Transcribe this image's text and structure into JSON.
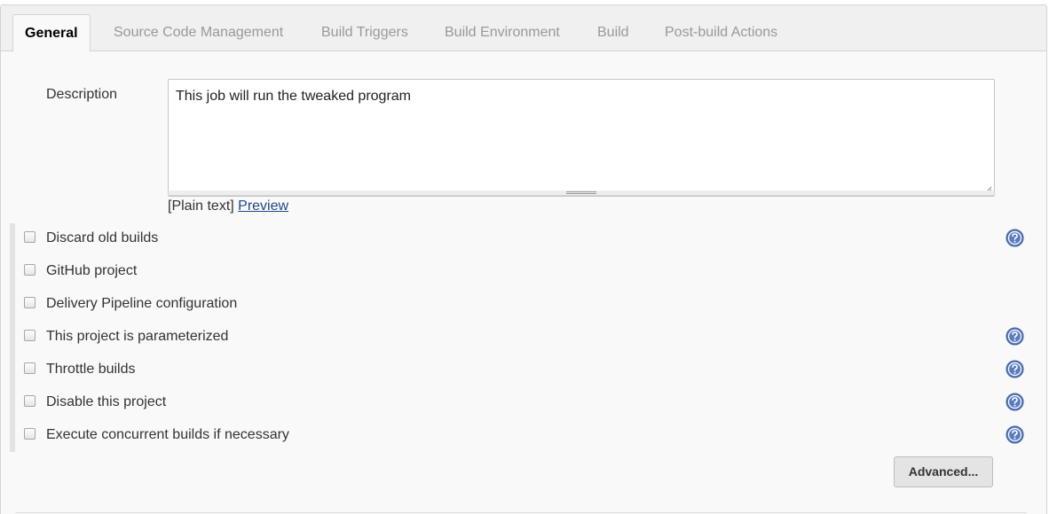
{
  "tabs": [
    {
      "label": "General",
      "active": true
    },
    {
      "label": "Source Code Management",
      "active": false
    },
    {
      "label": "Build Triggers",
      "active": false
    },
    {
      "label": "Build Environment",
      "active": false
    },
    {
      "label": "Build",
      "active": false
    },
    {
      "label": "Post-build Actions",
      "active": false
    }
  ],
  "description": {
    "label": "Description",
    "value": "This job will run the tweaked program",
    "format_prefix": "[Plain text]",
    "preview_link": "Preview"
  },
  "options": [
    {
      "label": "Discard old builds",
      "checked": false,
      "has_help": true
    },
    {
      "label": "GitHub project",
      "checked": false,
      "has_help": false
    },
    {
      "label": "Delivery Pipeline configuration",
      "checked": false,
      "has_help": false
    },
    {
      "label": "This project is parameterized",
      "checked": false,
      "has_help": true
    },
    {
      "label": "Throttle builds",
      "checked": false,
      "has_help": true
    },
    {
      "label": "Disable this project",
      "checked": false,
      "has_help": true
    },
    {
      "label": "Execute concurrent builds if necessary",
      "checked": false,
      "has_help": true
    }
  ],
  "advanced_button": "Advanced...",
  "colors": {
    "help_icon": "#5a7bbd",
    "link": "#204a87",
    "tab_inactive": "#999999",
    "panel_bg": "#f9f9f9"
  },
  "icons": {
    "help": "question-circle-icon",
    "resize": "resize-grip-icon"
  }
}
